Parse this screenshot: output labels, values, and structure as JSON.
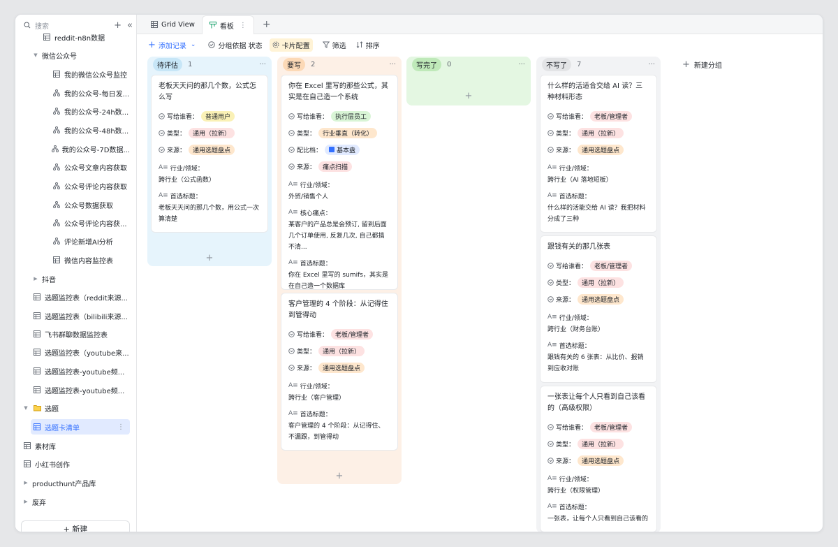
{
  "sidebar": {
    "search_placeholder": "搜索",
    "items": [
      {
        "label": "reddit-n8n数据",
        "type": "table",
        "indent": 2
      },
      {
        "label": "微信公众号",
        "type": "folder-open",
        "indent": 1
      },
      {
        "label": "我的微信公众号监控",
        "type": "table",
        "indent": 3
      },
      {
        "label": "我的公众号-每日发...",
        "type": "workflow",
        "indent": 3
      },
      {
        "label": "我的公众号-24h数...",
        "type": "workflow",
        "indent": 3
      },
      {
        "label": "我的公众号-48h数...",
        "type": "workflow",
        "indent": 3
      },
      {
        "label": "我的公众号-7D数据...",
        "type": "workflow",
        "indent": 3
      },
      {
        "label": "公众号文章内容获取",
        "type": "workflow",
        "indent": 3
      },
      {
        "label": "公众号评论内容获取",
        "type": "workflow",
        "indent": 3
      },
      {
        "label": "公众号数据获取",
        "type": "workflow",
        "indent": 3
      },
      {
        "label": "公众号评论内容获...",
        "type": "workflow",
        "indent": 3
      },
      {
        "label": "评论新增AI分析",
        "type": "workflow",
        "indent": 3
      },
      {
        "label": "微信内容监控表",
        "type": "table",
        "indent": 3
      },
      {
        "label": "抖音",
        "type": "folder-closed",
        "indent": 1
      },
      {
        "label": "选题监控表（reddit来源...",
        "type": "table",
        "indent": 1
      },
      {
        "label": "选题监控表（bilibili来源...",
        "type": "table",
        "indent": 1
      },
      {
        "label": "飞书群聊数据监控表",
        "type": "table",
        "indent": 1
      },
      {
        "label": "选题监控表（youtube来...",
        "type": "table",
        "indent": 1
      },
      {
        "label": "选题监控表-youtube频...",
        "type": "table",
        "indent": 1
      },
      {
        "label": "选题监控表-youtube频...",
        "type": "table",
        "indent": 1
      },
      {
        "label": "选题",
        "type": "folder-yellow",
        "indent": 0
      },
      {
        "label": "选题卡清单",
        "type": "table",
        "indent": 1,
        "active": true
      },
      {
        "label": "素材库",
        "type": "table",
        "indent": 0
      },
      {
        "label": "小红书创作",
        "type": "table",
        "indent": 0
      },
      {
        "label": "producthunt产品库",
        "type": "folder-closed",
        "indent": 0
      },
      {
        "label": "废弃",
        "type": "folder-closed",
        "indent": 0
      }
    ],
    "new_button": "+ 新建"
  },
  "tabs": [
    {
      "label": "Grid View",
      "icon": "grid-icon",
      "active": false
    },
    {
      "label": "看板",
      "icon": "kanban-icon",
      "active": true
    }
  ],
  "toolbar": {
    "add_record": "添加记录",
    "group_by": "分组依据 状态",
    "card_config": "卡片配置",
    "filter": "筛选",
    "sort": "排序"
  },
  "labels": {
    "audience": "写给谁看：",
    "type": "类型：",
    "source": "来源：",
    "match": "配比档：",
    "industry": "行业/领域：",
    "core": "核心痛点：",
    "headline": "首选标题："
  },
  "columns": [
    {
      "name": "待评估",
      "count": "1",
      "bg": "#e6f4fc",
      "tag_bg": "#c7e6f7",
      "cards": [
        {
          "title": "老板天天问的那几个数，公式怎么写",
          "audience": "普通用户",
          "audience_color": "yellow",
          "type": "通用（拉新）",
          "source": "通用选题盘点",
          "industry": "跨行业（公式函数）",
          "headline": "老板天天问的那几个数，用公式一次算清楚"
        }
      ]
    },
    {
      "name": "要写",
      "count": "2",
      "bg": "#fdf0e6",
      "tag_bg": "#fcd9b6",
      "cards": [
        {
          "title": "你在 Excel 里写的那些公式，其实是在自己造一个系统",
          "audience": "执行层员工",
          "audience_color": "green",
          "type": "行业垂直（转化）",
          "type_color": "orange",
          "match": "基本盘",
          "source": "痛点扫描",
          "source_color": "pink",
          "industry": "外贸/销售个人",
          "core": "某客户的产品总是会预订, 留到后面几个订单使用, 反复几次, 自己都搞不清...",
          "headline": "你在 Excel 里写的 sumifs，其实是在自己造一个数据库"
        },
        {
          "title": "客户管理的 4 个阶段：从记得住到管得动",
          "audience": "老板/管理者",
          "audience_color": "pink",
          "type": "通用（拉新）",
          "source": "通用选题盘点",
          "industry": "跨行业（客户管理）",
          "headline": "客户管理的 4 个阶段：从记得住、不漏跟，到管得动"
        }
      ]
    },
    {
      "name": "写完了",
      "count": "0",
      "bg": "#e4f7e2",
      "tag_bg": "#bfe9b9",
      "cards": []
    },
    {
      "name": "不写了",
      "count": "7",
      "bg": "#f2f3f5",
      "tag_bg": "#e3e4e6",
      "cards": [
        {
          "title": "什么样的活适合交给 AI 读？三种材料形态",
          "audience": "老板/管理者",
          "audience_color": "pink",
          "type": "通用（拉新）",
          "source": "通用选题盘点",
          "industry": "跨行业（AI 落地短板）",
          "headline": "什么样的活能交给 AI 读？我把材料分成了三种"
        },
        {
          "title": "跟钱有关的那几张表",
          "audience": "老板/管理者",
          "audience_color": "pink",
          "type": "通用（拉新）",
          "source": "通用选题盘点",
          "industry": "跨行业（财务台账）",
          "headline": "跟钱有关的 6 张表：从比价、报销到应收对账"
        },
        {
          "title": "一张表让每个人只看到自己该看的（高级权限）",
          "audience": "老板/管理者",
          "audience_color": "pink",
          "type": "通用（拉新）",
          "source": "通用选题盘点",
          "industry": "跨行业（权限管理）",
          "headline": "一张表，让每个人只看到自己该看的"
        }
      ]
    }
  ],
  "new_group": "新建分组"
}
